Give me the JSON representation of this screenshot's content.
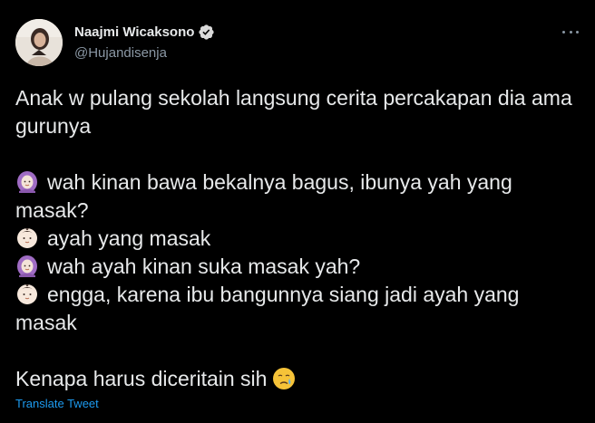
{
  "author": {
    "display_name": "Naajmi Wicaksono",
    "handle": "@Hujandisenja",
    "verified_icon": "verified-badge-icon",
    "avatar_icon": "avatar"
  },
  "more_icon": "more-horizontal-icon",
  "tweet": {
    "intro": "Anak w pulang sekolah langsung cerita percakapan dia ama gurunya",
    "dialogue": [
      {
        "speaker_icon": "woman-with-headscarf-icon",
        "text": "wah kinan bawa bekalnya bagus, ibunya yah yang masak?"
      },
      {
        "speaker_icon": "baby-face-icon",
        "text": "ayah yang masak"
      },
      {
        "speaker_icon": "woman-with-headscarf-icon",
        "text": "wah ayah kinan suka masak yah?"
      },
      {
        "speaker_icon": "baby-face-icon",
        "text": "engga, karena ibu bangunnya siang jadi ayah yang masak"
      }
    ],
    "closing": "Kenapa harus diceritain sih",
    "closing_icon": "crying-face-icon"
  },
  "translate_label": "Translate Tweet",
  "colors": {
    "background": "#000000",
    "text_primary": "#e7e9ea",
    "text_secondary": "#8b98a5",
    "link": "#1d9bf0",
    "verified_badge": "#d9d9d9"
  }
}
